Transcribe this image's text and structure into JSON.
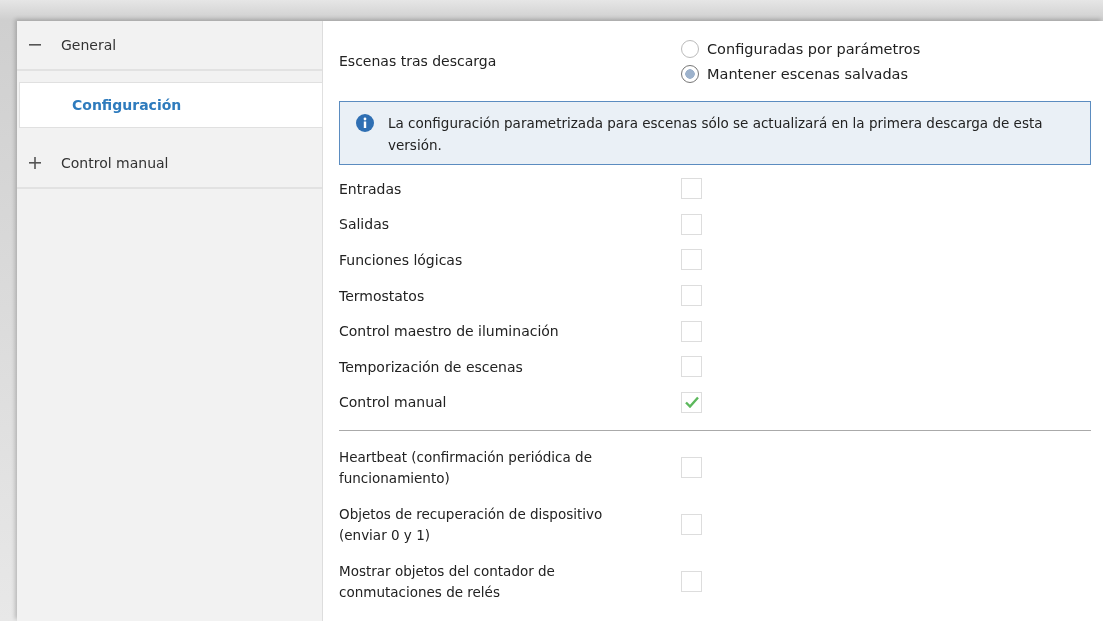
{
  "sidebar": {
    "items": [
      {
        "label": "General",
        "expanded": true,
        "children": [
          {
            "label": "Configuración",
            "selected": true
          }
        ]
      },
      {
        "label": "Control manual",
        "expanded": false
      }
    ]
  },
  "scenes": {
    "label": "Escenas tras descarga",
    "options": [
      {
        "label": "Configuradas por parámetros",
        "selected": false
      },
      {
        "label": "Mantener escenas salvadas",
        "selected": true
      }
    ]
  },
  "info": {
    "text": "La configuración parametrizada para escenas sólo se actualizará en la primera descarga de esta versión."
  },
  "options": [
    {
      "label": "Entradas",
      "checked": false
    },
    {
      "label": "Salidas",
      "checked": false
    },
    {
      "label": "Funciones lógicas",
      "checked": false
    },
    {
      "label": "Termostatos",
      "checked": false
    },
    {
      "label": "Control maestro de iluminación",
      "checked": false
    },
    {
      "label": "Temporización de escenas",
      "checked": false
    },
    {
      "label": "Control manual",
      "checked": true
    }
  ],
  "extra_options": [
    {
      "label": "Heartbeat (confirmación periódica de funcionamiento)",
      "checked": false
    },
    {
      "label": "Objetos de recuperación de dispositivo (enviar 0 y 1)",
      "checked": false
    },
    {
      "label": "Mostrar objetos del contador de conmutaciones de relés",
      "checked": false
    }
  ]
}
